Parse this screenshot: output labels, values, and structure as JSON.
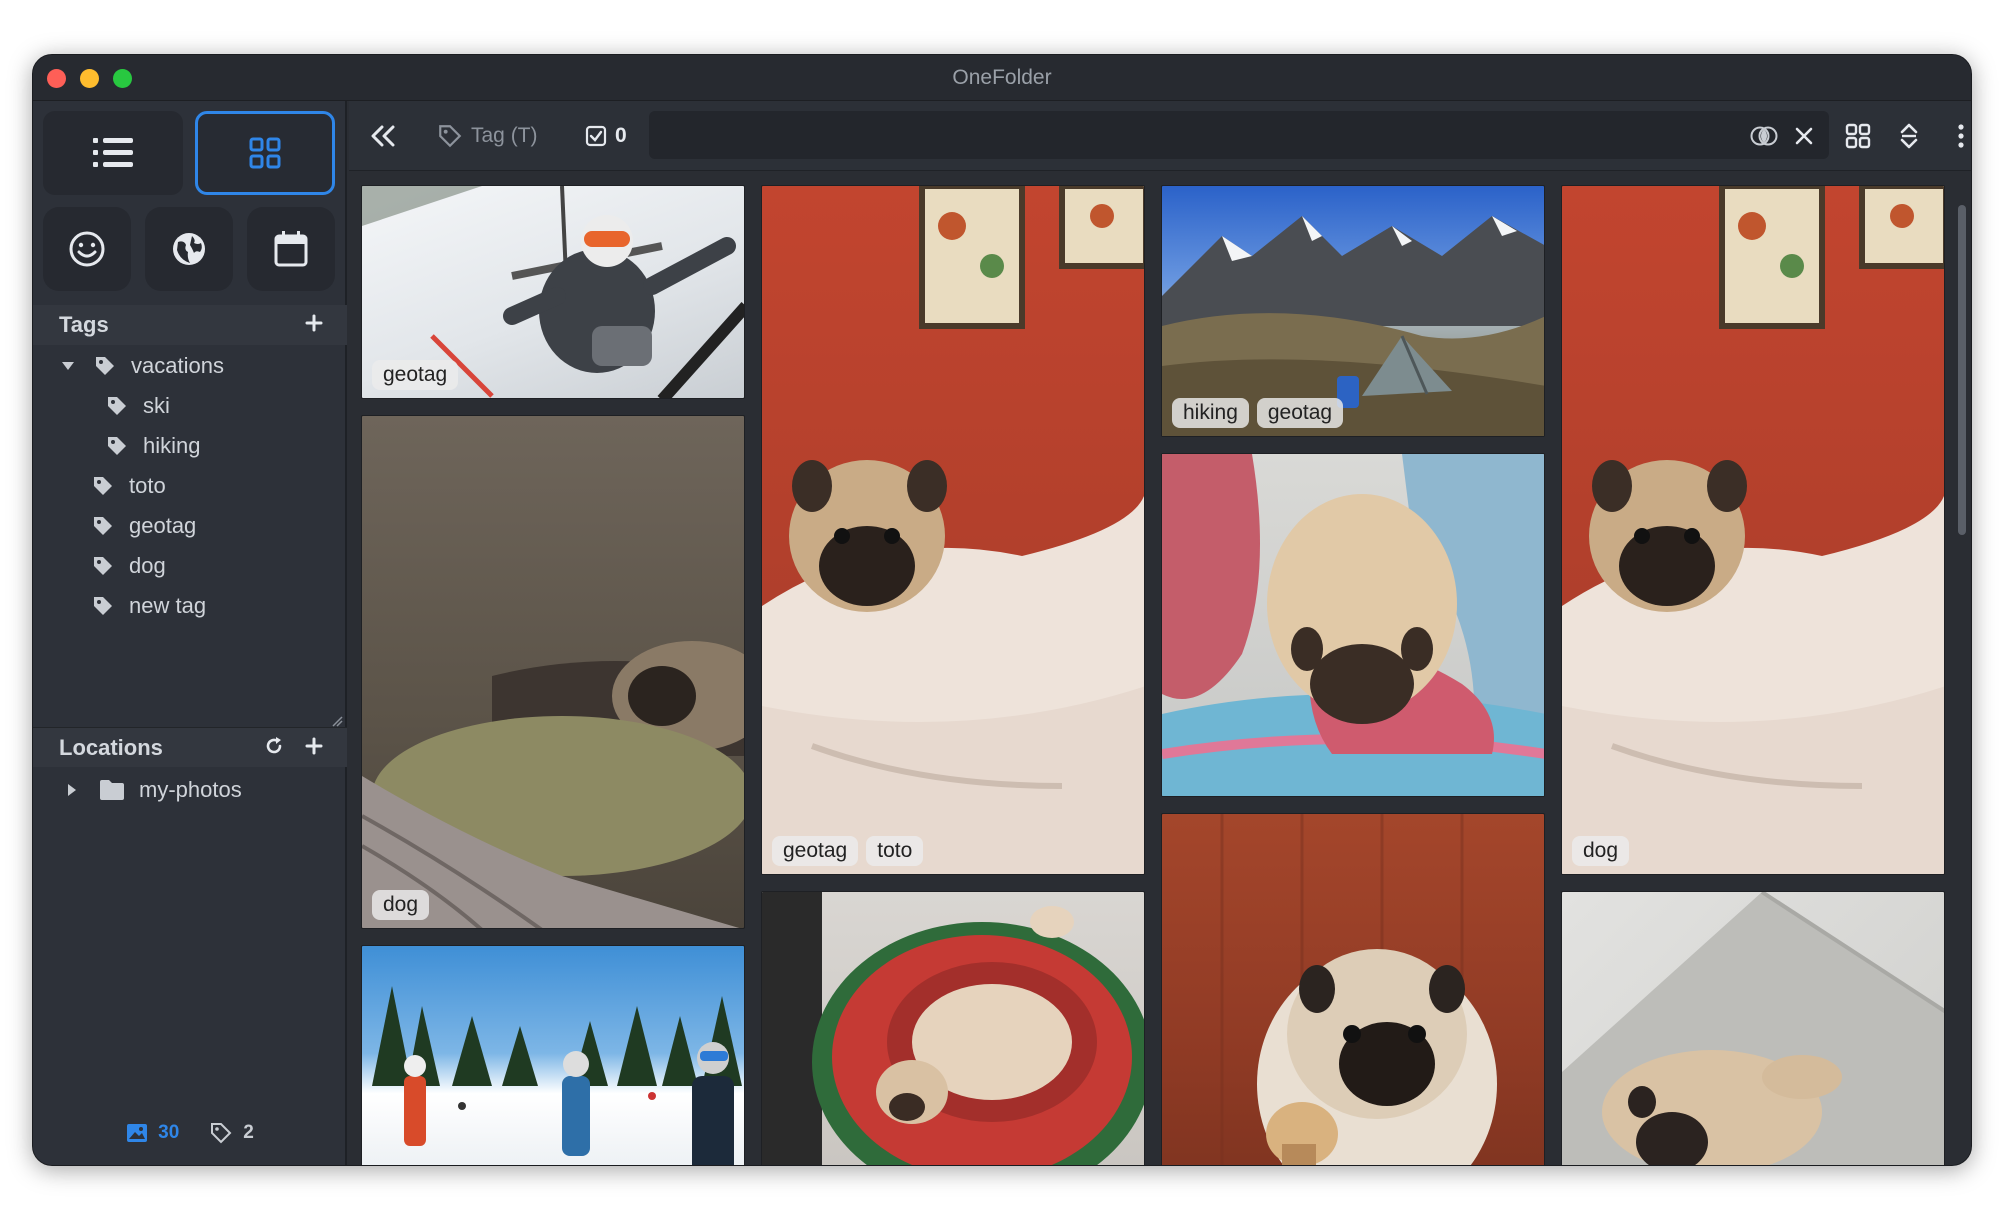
{
  "window": {
    "title": "OneFolder"
  },
  "colors": {
    "accent": "#2f86e8",
    "bg": "#2a2d33",
    "sidebar": "#2d3139"
  },
  "sidebar": {
    "view_buttons": [
      {
        "name": "list-view-icon",
        "active": false
      },
      {
        "name": "grid-view-icon",
        "active": true
      }
    ],
    "search_buttons": [
      "smiley-icon",
      "globe-icon",
      "calendar-icon"
    ],
    "tags_header": "Tags",
    "tags": [
      {
        "label": "vacations",
        "level": 0,
        "expanded": true
      },
      {
        "label": "ski",
        "level": 1
      },
      {
        "label": "hiking",
        "level": 1
      },
      {
        "label": "toto",
        "level": 0
      },
      {
        "label": "geotag",
        "level": 0
      },
      {
        "label": "dog",
        "level": 0
      },
      {
        "label": "new tag",
        "level": 0
      }
    ],
    "locations_header": "Locations",
    "locations": [
      {
        "label": "my-photos",
        "expanded": false
      }
    ],
    "status": {
      "images": "30",
      "tags": "2"
    }
  },
  "toolbar": {
    "tag_label": "Tag (T)",
    "selected_count": "0",
    "search_value": ""
  },
  "gallery": {
    "items": [
      {
        "scene": "ski-chairlift",
        "tags": [
          "geotag"
        ]
      },
      {
        "scene": "pug-bed-wall",
        "tags": [
          "geotag",
          "toto"
        ]
      },
      {
        "scene": "mountain-tent",
        "tags": [
          "hiking",
          "geotag"
        ]
      },
      {
        "scene": "pug-bed-wall",
        "tags": [
          "dog"
        ]
      },
      {
        "scene": "pug-dark-pillow",
        "tags": [
          "dog"
        ]
      },
      {
        "scene": "pug-pink-blanket",
        "tags": []
      },
      {
        "scene": "skiers-group",
        "tags": []
      },
      {
        "scene": "pug-watermelon-bed",
        "tags": []
      },
      {
        "scene": "pug-wood-wall",
        "tags": []
      },
      {
        "scene": "pug-floor",
        "tags": []
      }
    ]
  }
}
